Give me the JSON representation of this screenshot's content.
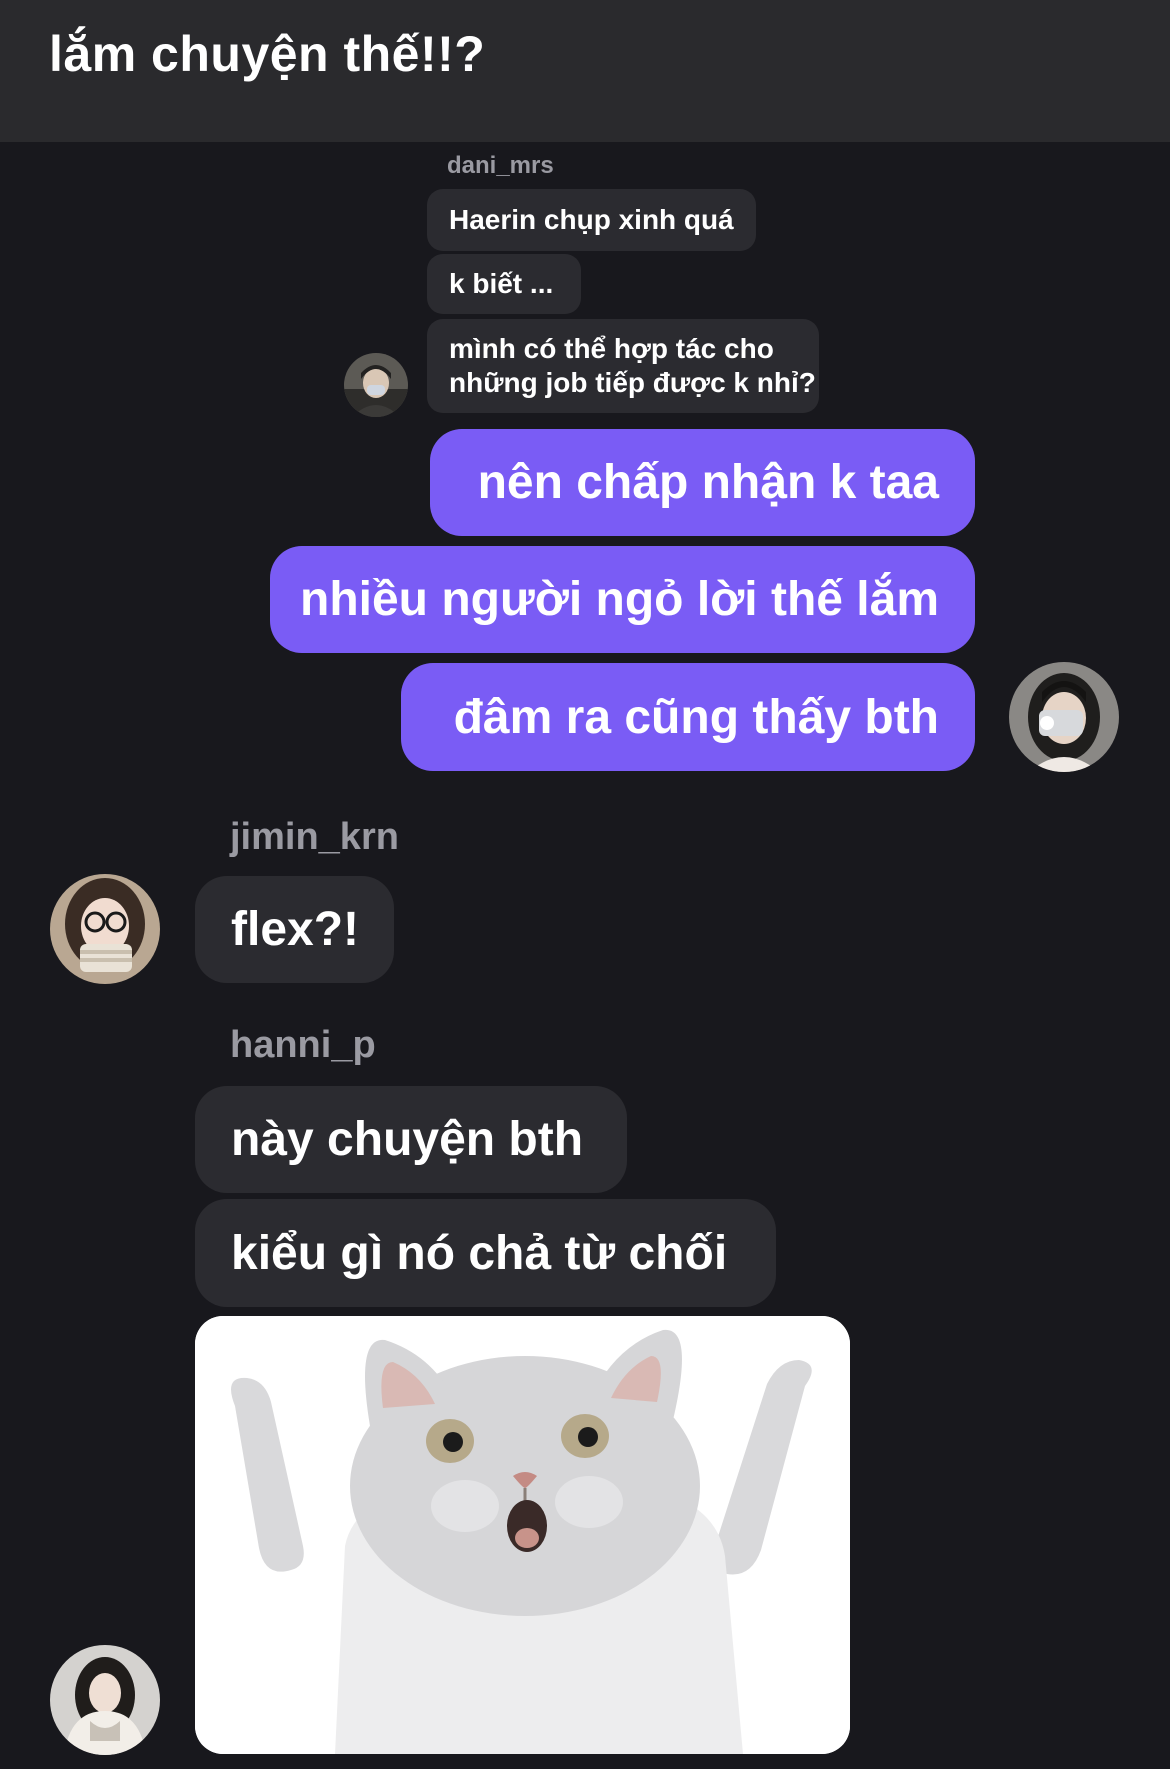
{
  "caption": "lắm chuyện thế!!?",
  "messages": {
    "dani": {
      "username": "dani_mrs",
      "lines": [
        "Haerin chụp xinh quá",
        "k biết ...",
        "mình có thể hợp tác cho",
        "những job tiếp được k nhỉ?"
      ]
    },
    "me": {
      "lines": [
        "nên chấp nhận k taa",
        "nhiều người ngỏ lời thế lắm",
        "đâm ra cũng thấy bth"
      ]
    },
    "jimin": {
      "username": "jimin_krn",
      "lines": [
        "flex?!"
      ]
    },
    "hanni": {
      "username": "hanni_p",
      "lines": [
        "này chuyện bth",
        "kiểu gì nó chả từ chối"
      ]
    }
  },
  "sticker": {
    "icon": "shrugging-cat-sticker",
    "background": "#ffffff"
  },
  "colors": {
    "outgoing_bubble": "#7a5cf5",
    "incoming_bubble": "#2b2b30",
    "background": "#18181d",
    "top_bar": "#2a2a2d",
    "username": "#9a9aa2"
  }
}
